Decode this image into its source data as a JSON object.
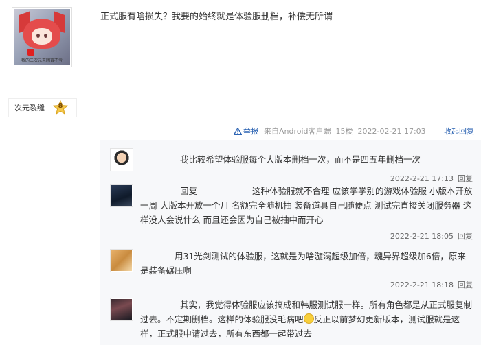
{
  "author": {
    "avatar_caption": "我的二次元天团百不亏",
    "username": "次元裂缝",
    "level": "8"
  },
  "post": {
    "text": "正式服有啥损失？我要的始终就是体验服删档，补偿无所谓",
    "report_label": "举报",
    "source": "来自Android客户端",
    "floor": "15楼",
    "datetime": "2022-02-21 17:03",
    "toggle_replies": "收起回复"
  },
  "replies": [
    {
      "text": "我比较希望体验服每个大版本删档一次，而不是四五年删档一次",
      "time": "2022-2-21 17:13",
      "reply_label": "回复"
    },
    {
      "reply_word": "回复",
      "text": "这种体验服就不合理 应该学学别的游戏体验服 小版本开放一周 大版本开放一个月 名额完全随机抽 装备道具自己随便点 测试完直接关闭服务器 这样没人会说什么 而且还会因为自己被抽中而开心",
      "time": "2022-2-21 18:05",
      "reply_label": "回复"
    },
    {
      "text": "用31光剑测试的体验服，这就是为啥漩涡超级加倍，魂异界超级加6倍，原来是装备碾压啊",
      "time": "2022-2-21 18:18",
      "reply_label": "回复"
    },
    {
      "text_before_emoji": "其实，我觉得体验服应该搞成和韩服测试服一样。所有角色都是从正式服复制过去。不定期删档。这样的体验服没毛病吧",
      "text_after_emoji": "反正以前梦幻更新版本，测试服就是这样，正式服申请过去，所有东西都一起带过去"
    }
  ]
}
